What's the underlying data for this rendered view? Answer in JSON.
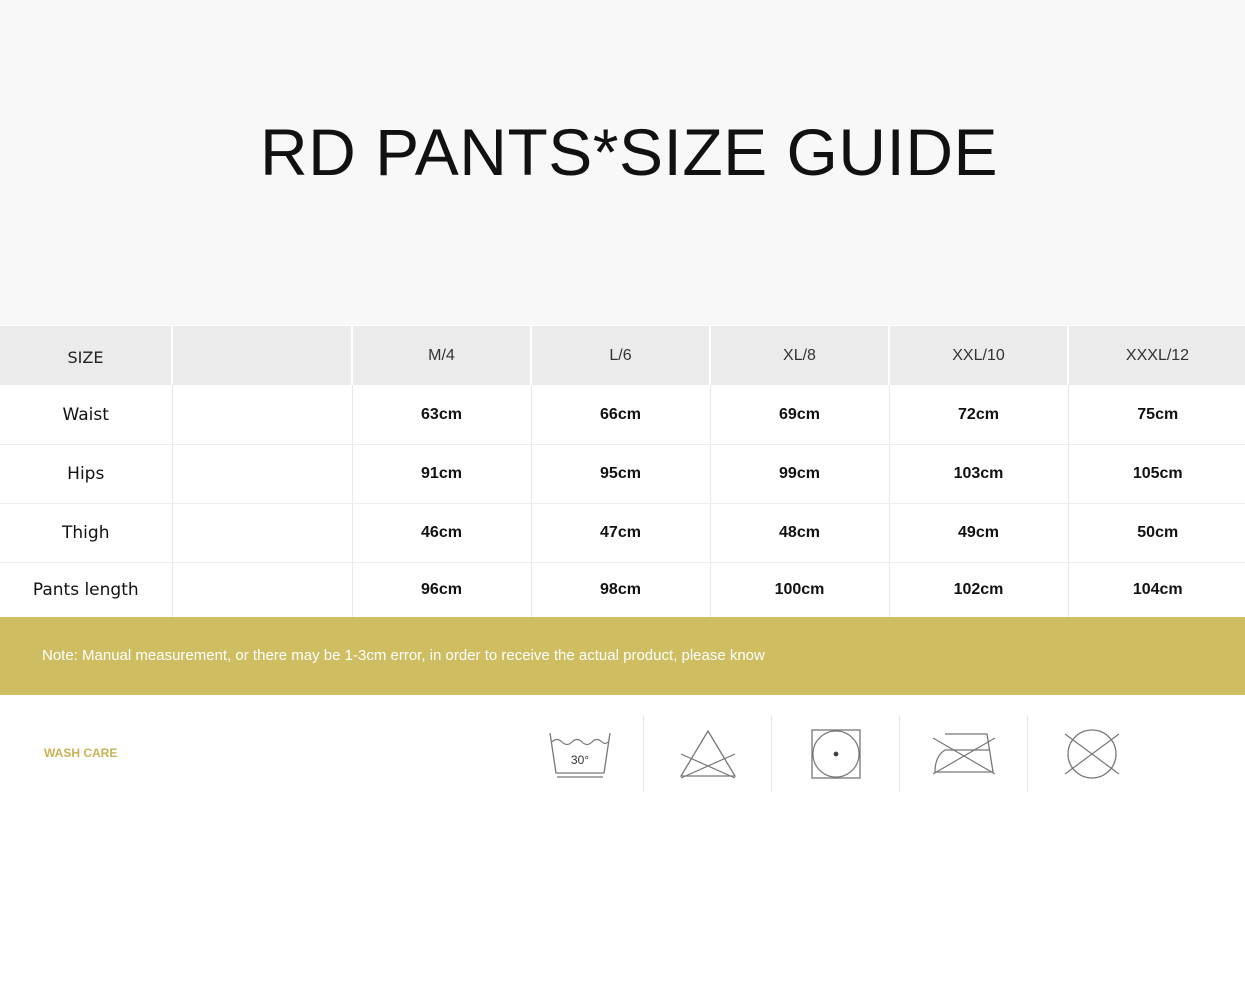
{
  "title": "RD PANTS*SIZE GUIDE",
  "table": {
    "headers": [
      "SIZE",
      "",
      "M/4",
      "L/6",
      "XL/8",
      "XXL/10",
      "XXXL/12"
    ],
    "rows": [
      {
        "label": "Waist",
        "values": [
          "63cm",
          "66cm",
          "69cm",
          "72cm",
          "75cm"
        ]
      },
      {
        "label": "Hips",
        "values": [
          "91cm",
          "95cm",
          "99cm",
          "103cm",
          "105cm"
        ]
      },
      {
        "label": "Thigh",
        "values": [
          "46cm",
          "47cm",
          "48cm",
          "49cm",
          "50cm"
        ]
      },
      {
        "label": "Pants length",
        "values": [
          "96cm",
          "98cm",
          "100cm",
          "102cm",
          "104cm"
        ]
      }
    ]
  },
  "note": "Note: Manual measurement, or there may be 1-3cm error, in order to receive the actual product, please know",
  "wash_care": {
    "label": "WASH CARE",
    "temperature": "30°",
    "icons": [
      "wash-30-icon",
      "no-bleach-icon",
      "tumble-dry-icon",
      "no-iron-icon",
      "no-dry-clean-icon"
    ]
  },
  "colors": {
    "accent": "#cfbd61",
    "header_bg": "#f8f8f8",
    "table_head_bg": "#ebebeb"
  }
}
